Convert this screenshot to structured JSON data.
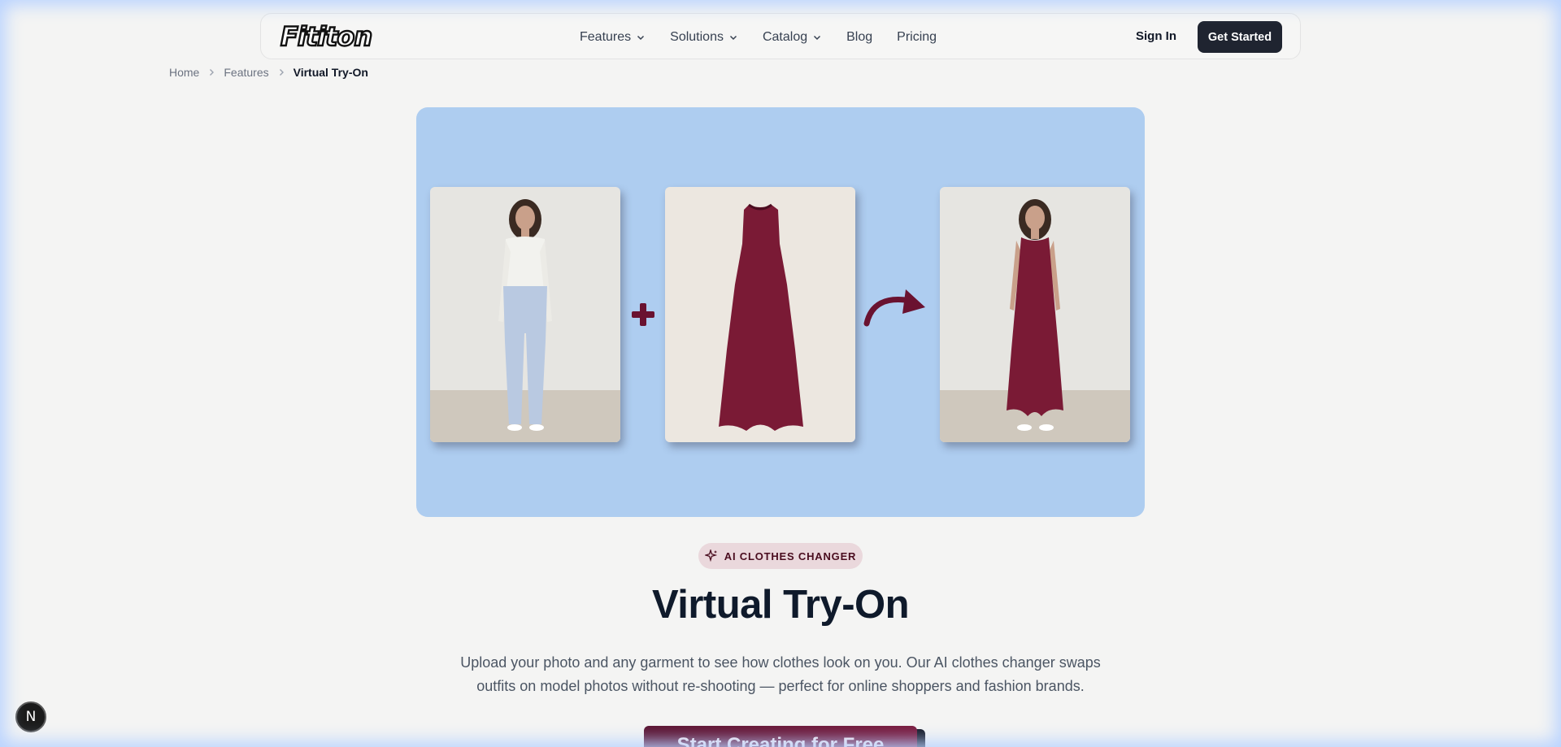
{
  "brand": {
    "logo_text": "Fititon"
  },
  "nav": {
    "items": [
      {
        "label": "Features",
        "has_dropdown": true
      },
      {
        "label": "Solutions",
        "has_dropdown": true
      },
      {
        "label": "Catalog",
        "has_dropdown": true
      },
      {
        "label": "Blog",
        "has_dropdown": false
      },
      {
        "label": "Pricing",
        "has_dropdown": false
      }
    ],
    "sign_in": "Sign In",
    "get_started": "Get Started"
  },
  "breadcrumb": [
    "Home",
    "Features",
    "Virtual Try-On"
  ],
  "hero": {
    "icons": [
      "plus-icon",
      "curved-arrow-icon"
    ],
    "colors": {
      "background": "#aecdf0",
      "garment": "#7a1a35"
    }
  },
  "badge": {
    "icon": "sparkle-icon",
    "label": "AI CLOTHES CHANGER"
  },
  "page_title": "Virtual Try-On",
  "description": {
    "line1": "Upload your photo and any garment to see how clothes look on you. Our AI clothes changer swaps",
    "line2": "outfits on model photos without re-shooting — perfect for online shoppers and fashion brands."
  },
  "cta": {
    "label": "Start Creating for Free"
  },
  "dev_badge": {
    "label": "N"
  }
}
